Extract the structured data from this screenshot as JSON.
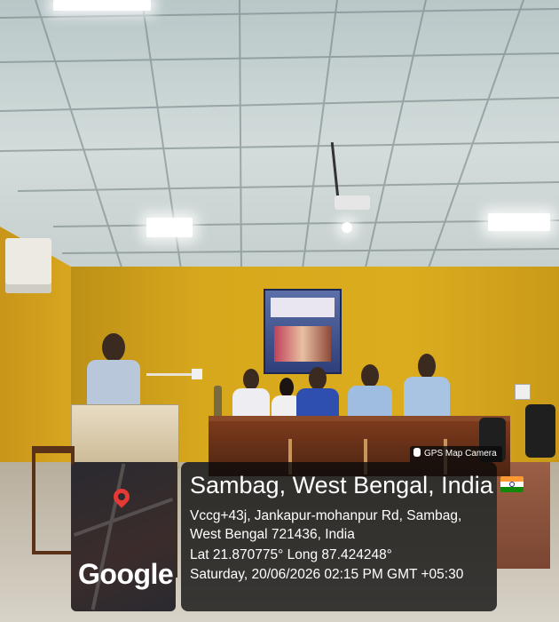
{
  "photo": {
    "description_visible_text": ""
  },
  "gps_stamp": {
    "app_badge": "GPS Map Camera",
    "map_logo": "Google",
    "place": "Sambag, West Bengal, India",
    "flag_icon": "india-flag-icon",
    "address": "Vccg+43j, Jankapur-mohanpur Rd, Sambag, West Bengal 721436, India",
    "coordinates": "Lat 21.870775° Long 87.424248°",
    "datetime": "Saturday, 20/06/2026 02:15 PM GMT +05:30"
  },
  "colors": {
    "wall": "#d8a81c",
    "overlay": "#0a0a0a",
    "map_pin": "#e53935"
  }
}
